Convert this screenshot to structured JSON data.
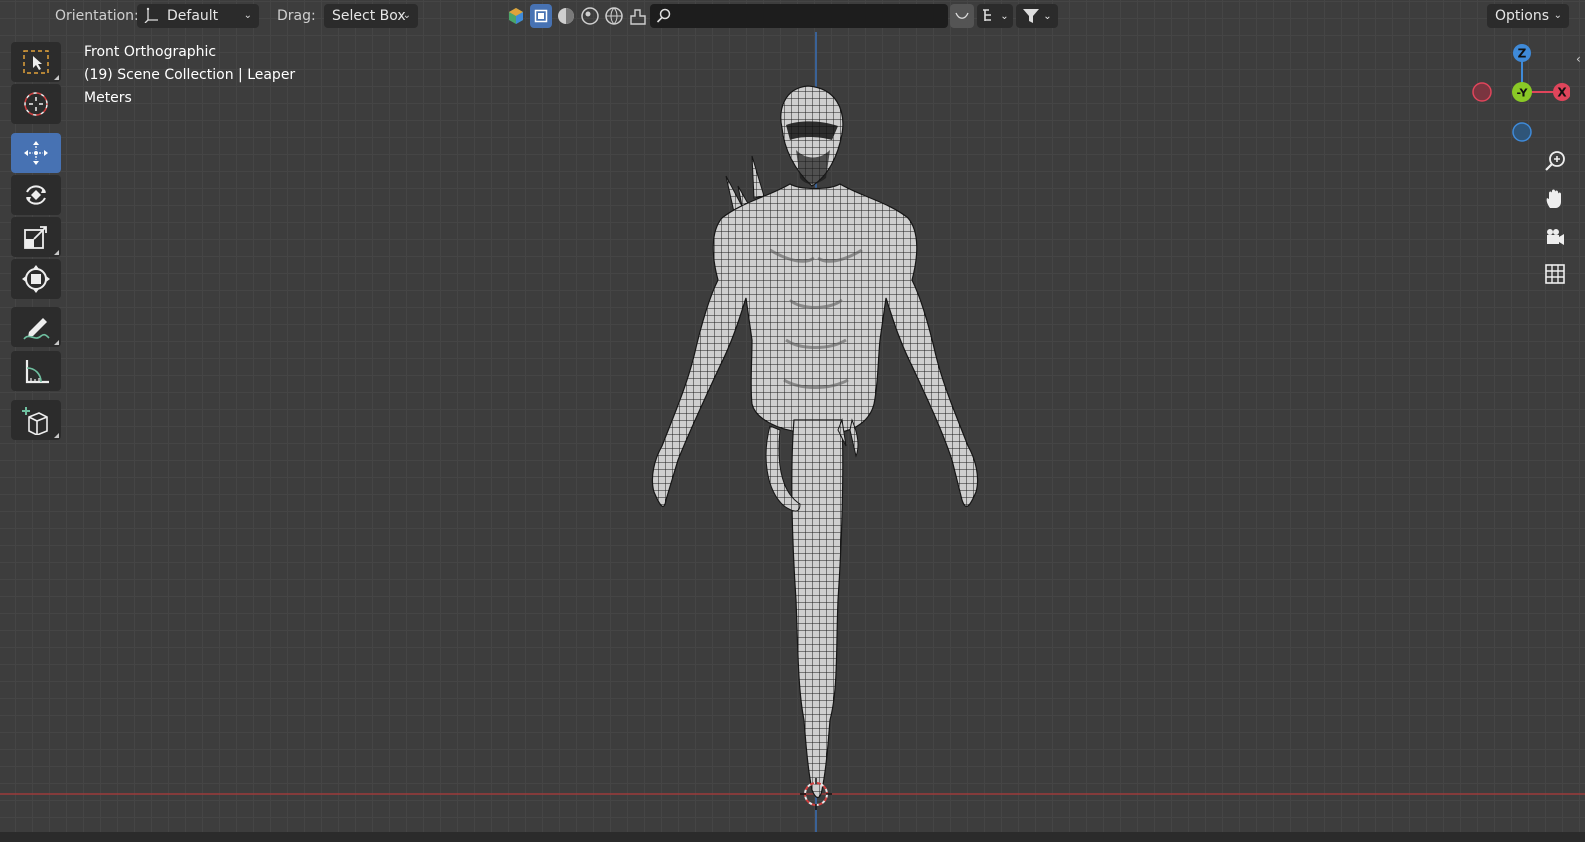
{
  "header": {
    "orientation_label": "Orientation:",
    "orientation_value": "Default",
    "drag_label": "Drag:",
    "drag_value": "Select Box",
    "search_placeholder": "",
    "options_label": "Options"
  },
  "viewport_info": {
    "view_name": "Front Orthographic",
    "collection": "(19) Scene Collection | Leaper",
    "units": "Meters"
  },
  "toolbar": {
    "tools": [
      "select-box",
      "cursor",
      "move",
      "rotate",
      "scale",
      "transform",
      "annotate",
      "measure",
      "add-cube"
    ],
    "active_tool": "move"
  },
  "gizmo": {
    "z_label": "Z",
    "y_label": "-Y",
    "x_label": "X",
    "colors": {
      "x": "#e0455b",
      "y": "#8ac926",
      "z": "#3f8ad8"
    }
  },
  "colors": {
    "viewport_bg": "#3d3d3d",
    "grid_line": "#454545",
    "x_axis": "#9b3b3b",
    "z_axis": "#3a6fb5",
    "active_tool": "#4772b3"
  }
}
